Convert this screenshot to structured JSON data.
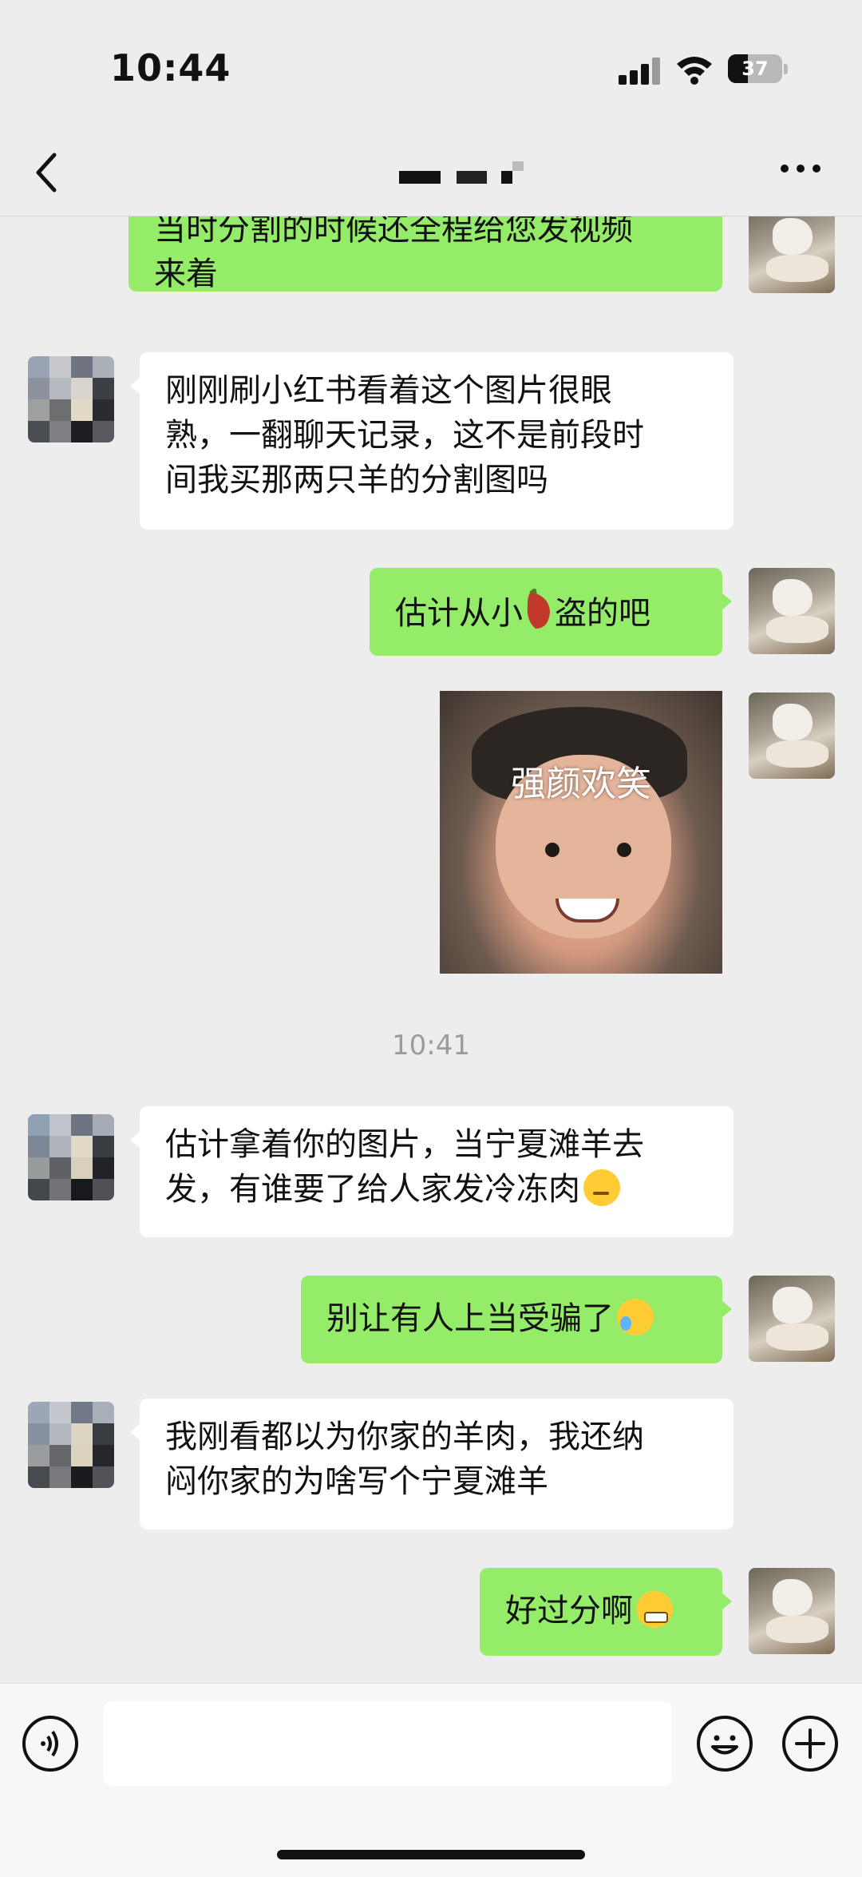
{
  "status_bar": {
    "time": "10:44",
    "battery_percent": "37",
    "battery_level": 0.37
  },
  "nav": {
    "back_icon": "chevron-left-icon",
    "title_masked": true,
    "more_icon": "more-dots-icon"
  },
  "messages": [
    {
      "side": "me",
      "lines": [
        "当时分割的时候还全程给您发视频",
        "来着"
      ]
    },
    {
      "side": "them",
      "lines": [
        "刚刚刷小红书看着这个图片很眼",
        "熟，一翻聊天记录，这不是前段时",
        "间我买那两只羊的分割图吗"
      ]
    },
    {
      "side": "me",
      "text_a": "估计从小",
      "icon": "sweet-potato-emoji",
      "text_b": "盗的吧"
    },
    {
      "side": "me",
      "sticker_caption": "强颜欢笑"
    },
    {
      "side": "them",
      "lines": [
        "估计拿着你的图片，当宁夏滩羊去",
        "发，有谁要了给人家发冷冻肉"
      ],
      "emoji": "thinking-emoji"
    },
    {
      "side": "me",
      "text": "别让有人上当受骗了",
      "emoji": "loudly-crying-emoji"
    },
    {
      "side": "them",
      "lines": [
        "我刚看都以为你家的羊肉，我还纳",
        "闷你家的为啥写个宁夏滩羊"
      ]
    },
    {
      "side": "me",
      "text": "好过分啊",
      "emoji": "grimace-tear-emoji"
    }
  ],
  "timestamp": "10:41",
  "input_bar": {
    "voice_icon": "voice-icon",
    "input_value": "",
    "emoji_icon": "emoji-face-icon",
    "plus_icon": "plus-icon"
  },
  "colors": {
    "background": "#ededed",
    "my_bubble": "#95ec69",
    "their_bubble": "#ffffff",
    "timestamp": "#9b9b9b"
  }
}
